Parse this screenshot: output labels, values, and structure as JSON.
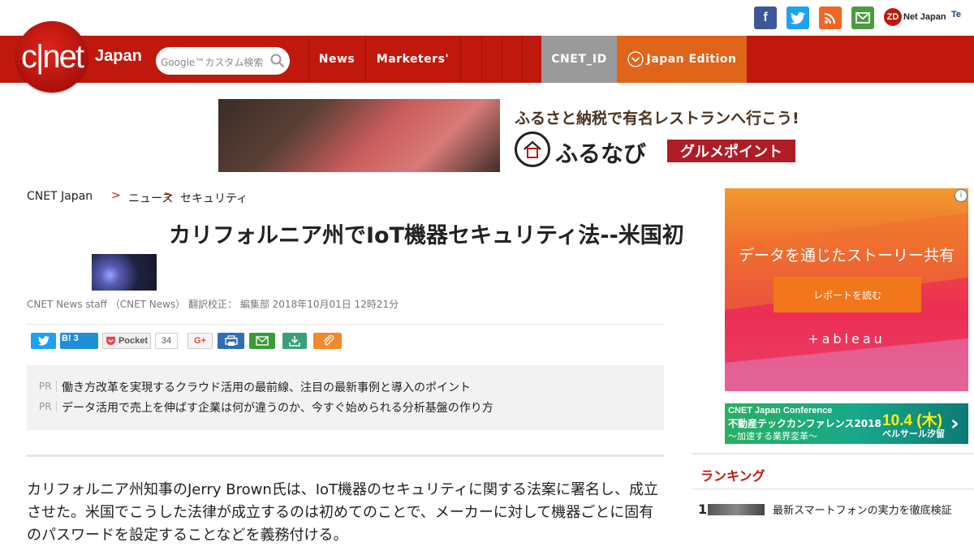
{
  "social": {
    "facebook": "f",
    "twitter": "t",
    "rss": "rss",
    "mail": "mail",
    "zdnet": "Net Japan",
    "zd": "ZD",
    "tech": "Te"
  },
  "header": {
    "logo": "c|net",
    "logo_sub": "Japan",
    "search_placeholder": "Google™カスタム検索",
    "nav": [
      "News",
      "Marketers'"
    ],
    "cnet_id": "CNET_ID",
    "edition": "Japan Edition"
  },
  "banner": {
    "headline": "ふるさと納税で有名レストランへ行こう!",
    "brand": "ふるなび",
    "badge": "グルメポイント"
  },
  "breadcrumb": [
    "CNET Japan",
    "ニュース",
    "セキュリティ"
  ],
  "article": {
    "title": "カリフォルニア州でIoT機器セキュリティ法--米国初",
    "byline": "CNET News staff （CNET News） 翻訳校正： 編集部 2018年10月01日 12時21分",
    "body": "カリフォルニア州知事のJerry Brown氏は、IoT機器のセキュリティに関する法案に署名し、成立させた。米国でこうした法律が成立するのは初めてのことで、メーカーに対して機器ごとに固有のパスワードを設定することなどを義務付ける。"
  },
  "share": {
    "twitter": "",
    "hatena": "B!",
    "hatena_count": "3",
    "pocket": "Pocket",
    "pocket_count": "34",
    "gplus": "G+"
  },
  "pr": {
    "tag": "PR",
    "items": [
      "働き方改革を実現するクラウド活用の最前線、注目の最新事例と導入のポイント",
      "データ活用で売上を伸ばす企業は何が違うのか、今すぐ始められる分析基盤の作り方"
    ]
  },
  "sidebar": {
    "ad_headline": "データを通じたストーリー共有",
    "ad_button": "レポートを読む",
    "ad_brand": "+ableau",
    "ad_info": "i",
    "conf_name": "CNET Japan Conference",
    "conf_title": "不動産テックカンファレンス2018",
    "conf_sub": "～加速する業界変革～",
    "conf_date": "10.4 (木)",
    "conf_venue": "ベルサール汐留",
    "ranking_head": "ランキング",
    "ranking": [
      {
        "rank": "1",
        "title": "最新スマートフォンの実力を徹底検証"
      }
    ]
  }
}
